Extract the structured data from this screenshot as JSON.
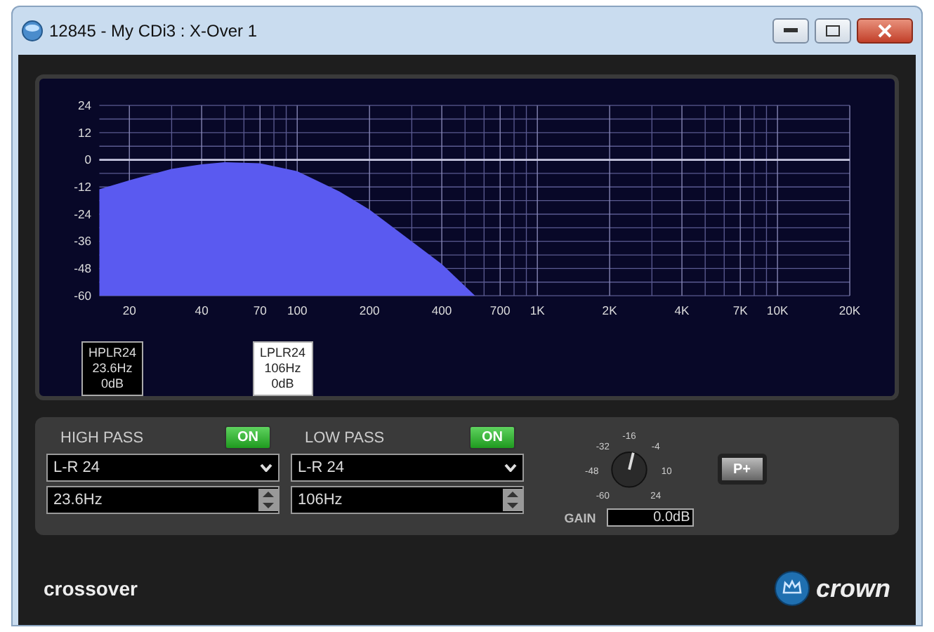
{
  "window": {
    "title": "12845 - My CDi3 : X-Over 1"
  },
  "chart": {
    "y_axis_labels": [
      "24",
      "12",
      "0",
      "-12",
      "-24",
      "-36",
      "-48",
      "-60"
    ],
    "x_axis_labels": [
      "20",
      "40",
      "70",
      "100",
      "200",
      "400",
      "700",
      "1K",
      "2K",
      "4K",
      "7K",
      "10K",
      "20K"
    ],
    "markers": [
      {
        "lines": [
          "HPLR24",
          "23.6Hz",
          "0dB"
        ],
        "selected": false
      },
      {
        "lines": [
          "LPLR24",
          "106Hz",
          "0dB"
        ],
        "selected": true
      }
    ]
  },
  "filters": [
    {
      "label": "HIGH PASS",
      "on": true,
      "on_label": "ON",
      "type": "L-R 24",
      "frequency": "23.6Hz"
    },
    {
      "label": "LOW PASS",
      "on": true,
      "on_label": "ON",
      "type": "L-R 24",
      "frequency": "106Hz"
    }
  ],
  "gain": {
    "knob_labels": [
      "-60",
      "-48",
      "-32",
      "-16",
      "-4",
      "10",
      "24"
    ],
    "level": 0.55,
    "label": "GAIN",
    "value": "0.0dB"
  },
  "preset_button": "P+",
  "footer": {
    "title": "crossover",
    "brand": "crown"
  }
}
